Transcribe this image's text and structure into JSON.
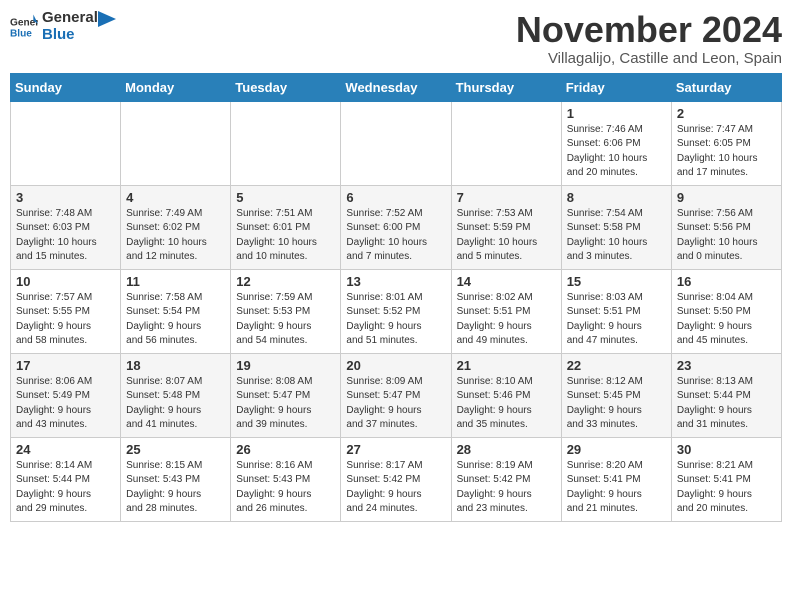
{
  "header": {
    "logo_general": "General",
    "logo_blue": "Blue",
    "month_title": "November 2024",
    "location": "Villagalijo, Castille and Leon, Spain"
  },
  "calendar": {
    "days_of_week": [
      "Sunday",
      "Monday",
      "Tuesday",
      "Wednesday",
      "Thursday",
      "Friday",
      "Saturday"
    ],
    "weeks": [
      [
        {
          "day": "",
          "info": ""
        },
        {
          "day": "",
          "info": ""
        },
        {
          "day": "",
          "info": ""
        },
        {
          "day": "",
          "info": ""
        },
        {
          "day": "",
          "info": ""
        },
        {
          "day": "1",
          "info": "Sunrise: 7:46 AM\nSunset: 6:06 PM\nDaylight: 10 hours\nand 20 minutes."
        },
        {
          "day": "2",
          "info": "Sunrise: 7:47 AM\nSunset: 6:05 PM\nDaylight: 10 hours\nand 17 minutes."
        }
      ],
      [
        {
          "day": "3",
          "info": "Sunrise: 7:48 AM\nSunset: 6:03 PM\nDaylight: 10 hours\nand 15 minutes."
        },
        {
          "day": "4",
          "info": "Sunrise: 7:49 AM\nSunset: 6:02 PM\nDaylight: 10 hours\nand 12 minutes."
        },
        {
          "day": "5",
          "info": "Sunrise: 7:51 AM\nSunset: 6:01 PM\nDaylight: 10 hours\nand 10 minutes."
        },
        {
          "day": "6",
          "info": "Sunrise: 7:52 AM\nSunset: 6:00 PM\nDaylight: 10 hours\nand 7 minutes."
        },
        {
          "day": "7",
          "info": "Sunrise: 7:53 AM\nSunset: 5:59 PM\nDaylight: 10 hours\nand 5 minutes."
        },
        {
          "day": "8",
          "info": "Sunrise: 7:54 AM\nSunset: 5:58 PM\nDaylight: 10 hours\nand 3 minutes."
        },
        {
          "day": "9",
          "info": "Sunrise: 7:56 AM\nSunset: 5:56 PM\nDaylight: 10 hours\nand 0 minutes."
        }
      ],
      [
        {
          "day": "10",
          "info": "Sunrise: 7:57 AM\nSunset: 5:55 PM\nDaylight: 9 hours\nand 58 minutes."
        },
        {
          "day": "11",
          "info": "Sunrise: 7:58 AM\nSunset: 5:54 PM\nDaylight: 9 hours\nand 56 minutes."
        },
        {
          "day": "12",
          "info": "Sunrise: 7:59 AM\nSunset: 5:53 PM\nDaylight: 9 hours\nand 54 minutes."
        },
        {
          "day": "13",
          "info": "Sunrise: 8:01 AM\nSunset: 5:52 PM\nDaylight: 9 hours\nand 51 minutes."
        },
        {
          "day": "14",
          "info": "Sunrise: 8:02 AM\nSunset: 5:51 PM\nDaylight: 9 hours\nand 49 minutes."
        },
        {
          "day": "15",
          "info": "Sunrise: 8:03 AM\nSunset: 5:51 PM\nDaylight: 9 hours\nand 47 minutes."
        },
        {
          "day": "16",
          "info": "Sunrise: 8:04 AM\nSunset: 5:50 PM\nDaylight: 9 hours\nand 45 minutes."
        }
      ],
      [
        {
          "day": "17",
          "info": "Sunrise: 8:06 AM\nSunset: 5:49 PM\nDaylight: 9 hours\nand 43 minutes."
        },
        {
          "day": "18",
          "info": "Sunrise: 8:07 AM\nSunset: 5:48 PM\nDaylight: 9 hours\nand 41 minutes."
        },
        {
          "day": "19",
          "info": "Sunrise: 8:08 AM\nSunset: 5:47 PM\nDaylight: 9 hours\nand 39 minutes."
        },
        {
          "day": "20",
          "info": "Sunrise: 8:09 AM\nSunset: 5:47 PM\nDaylight: 9 hours\nand 37 minutes."
        },
        {
          "day": "21",
          "info": "Sunrise: 8:10 AM\nSunset: 5:46 PM\nDaylight: 9 hours\nand 35 minutes."
        },
        {
          "day": "22",
          "info": "Sunrise: 8:12 AM\nSunset: 5:45 PM\nDaylight: 9 hours\nand 33 minutes."
        },
        {
          "day": "23",
          "info": "Sunrise: 8:13 AM\nSunset: 5:44 PM\nDaylight: 9 hours\nand 31 minutes."
        }
      ],
      [
        {
          "day": "24",
          "info": "Sunrise: 8:14 AM\nSunset: 5:44 PM\nDaylight: 9 hours\nand 29 minutes."
        },
        {
          "day": "25",
          "info": "Sunrise: 8:15 AM\nSunset: 5:43 PM\nDaylight: 9 hours\nand 28 minutes."
        },
        {
          "day": "26",
          "info": "Sunrise: 8:16 AM\nSunset: 5:43 PM\nDaylight: 9 hours\nand 26 minutes."
        },
        {
          "day": "27",
          "info": "Sunrise: 8:17 AM\nSunset: 5:42 PM\nDaylight: 9 hours\nand 24 minutes."
        },
        {
          "day": "28",
          "info": "Sunrise: 8:19 AM\nSunset: 5:42 PM\nDaylight: 9 hours\nand 23 minutes."
        },
        {
          "day": "29",
          "info": "Sunrise: 8:20 AM\nSunset: 5:41 PM\nDaylight: 9 hours\nand 21 minutes."
        },
        {
          "day": "30",
          "info": "Sunrise: 8:21 AM\nSunset: 5:41 PM\nDaylight: 9 hours\nand 20 minutes."
        }
      ]
    ]
  }
}
